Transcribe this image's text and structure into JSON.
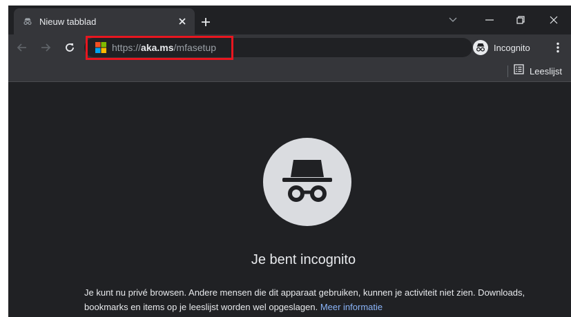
{
  "tab": {
    "title": "Nieuw tabblad",
    "favicon": "incognito-icon"
  },
  "toolbar": {
    "url_scheme": "https://",
    "url_host": "aka.ms",
    "url_path": "/mfasetup",
    "profile_label": "Incognito"
  },
  "bookmarks_bar": {
    "reading_list_label": "Leeslijst"
  },
  "content": {
    "heading": "Je bent incognito",
    "description": "Je kunt nu privé browsen. Andere mensen die dit apparaat gebruiken, kunnen je activiteit niet zien. Downloads, bookmarks en items op je leeslijst worden wel opgeslagen.",
    "learn_more_link": "Meer informatie"
  },
  "colors": {
    "frame_bg": "#202124",
    "toolbar_bg": "#35363a",
    "text": "#e8eaed",
    "link": "#8ab4f8",
    "highlight": "#e8161f"
  },
  "icons": [
    "incognito-icon",
    "close-icon",
    "plus-icon",
    "chevron-down-icon",
    "minimize-icon",
    "restore-icon",
    "window-close-icon",
    "back-arrow-icon",
    "forward-arrow-icon",
    "reload-icon",
    "microsoft-logo-icon",
    "more-vert-icon",
    "reading-list-icon"
  ]
}
